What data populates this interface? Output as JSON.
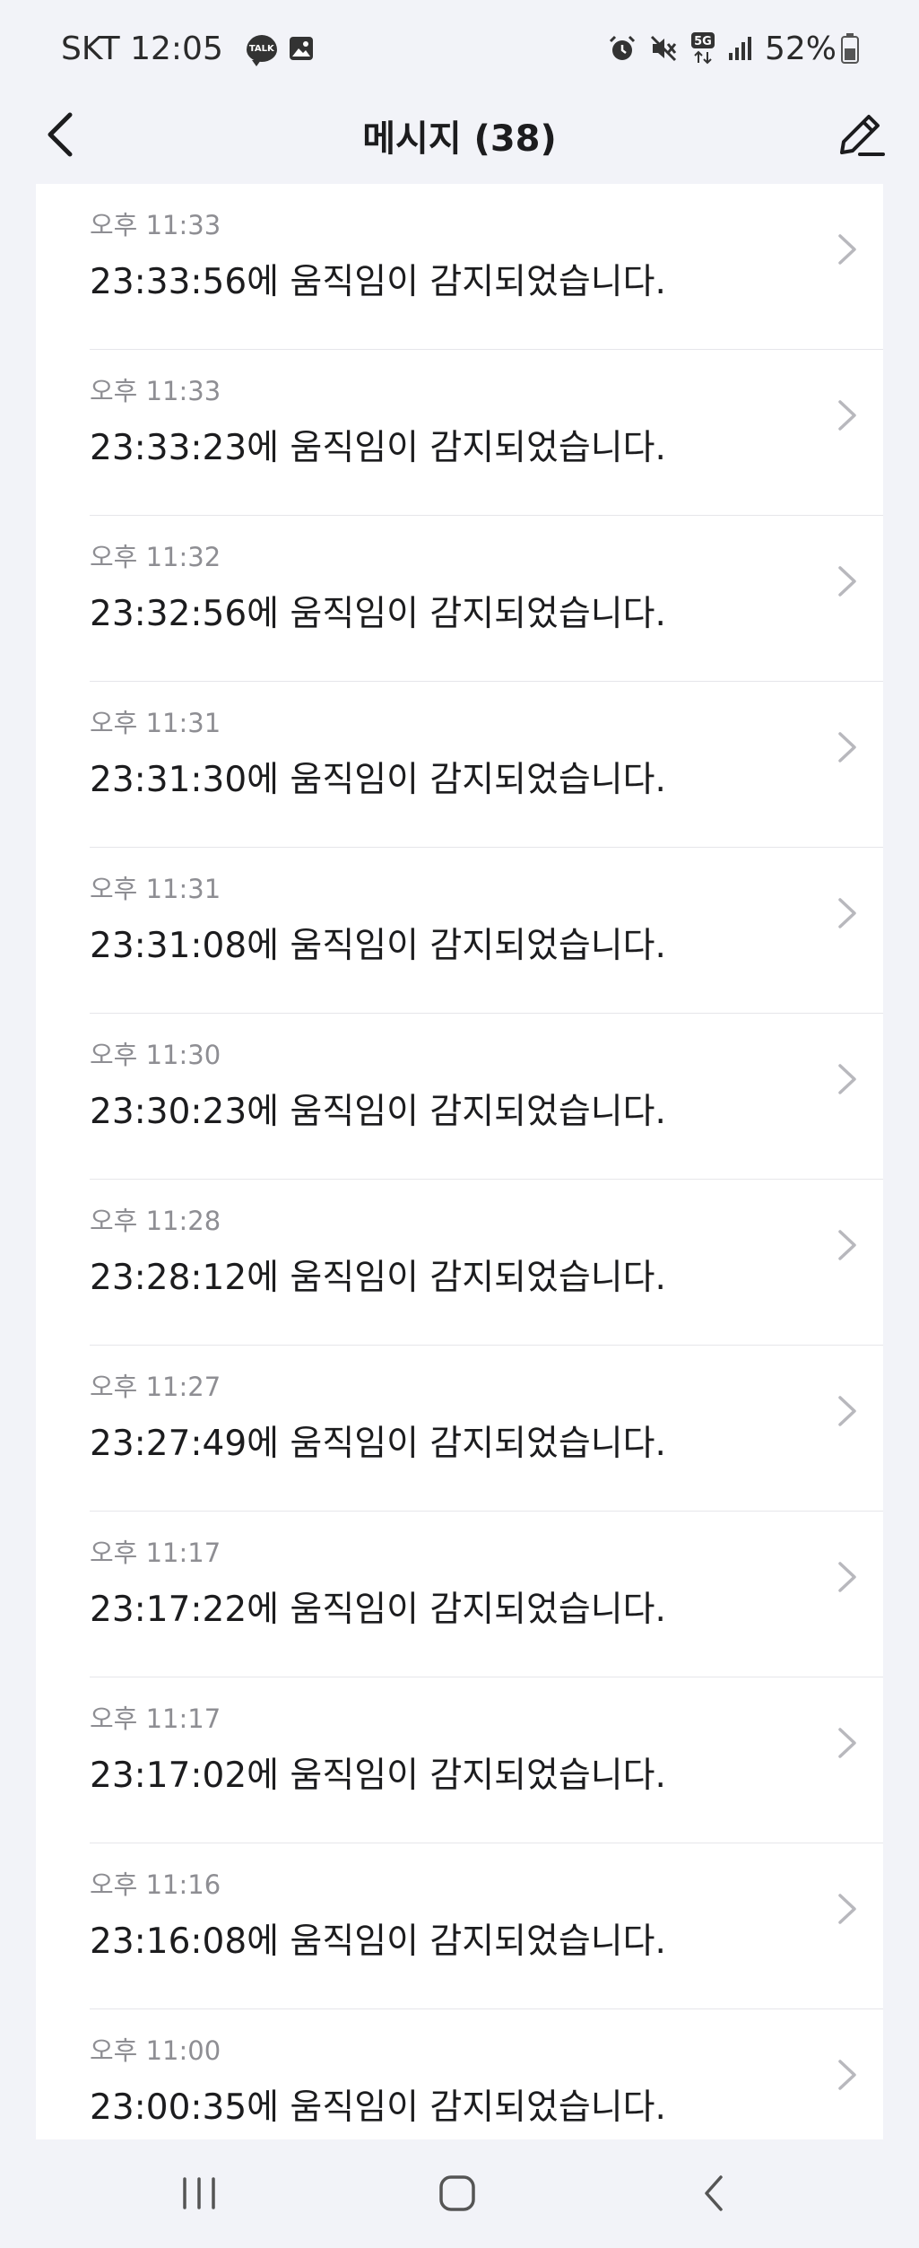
{
  "status_bar": {
    "carrier_time": "SKT 12:05",
    "talk_badge": "TALK",
    "battery": "52%",
    "network": "5G",
    "icons": [
      "talk-icon",
      "image-icon",
      "alarm-icon",
      "mute-icon",
      "5g-icon",
      "signal-icon",
      "battery-icon"
    ]
  },
  "header": {
    "title": "메시지 (38)",
    "back_icon": "back-arrow-icon",
    "edit_icon": "pencil-icon"
  },
  "messages": [
    {
      "time": "오후 11:33",
      "text": "23:33:56에 움직임이 감지되었습니다."
    },
    {
      "time": "오후 11:33",
      "text": "23:33:23에 움직임이 감지되었습니다."
    },
    {
      "time": "오후 11:32",
      "text": "23:32:56에 움직임이 감지되었습니다."
    },
    {
      "time": "오후 11:31",
      "text": "23:31:30에 움직임이 감지되었습니다."
    },
    {
      "time": "오후 11:31",
      "text": "23:31:08에 움직임이 감지되었습니다."
    },
    {
      "time": "오후 11:30",
      "text": "23:30:23에 움직임이 감지되었습니다."
    },
    {
      "time": "오후 11:28",
      "text": "23:28:12에 움직임이 감지되었습니다."
    },
    {
      "time": "오후 11:27",
      "text": "23:27:49에 움직임이 감지되었습니다."
    },
    {
      "time": "오후 11:17",
      "text": "23:17:22에 움직임이 감지되었습니다."
    },
    {
      "time": "오후 11:17",
      "text": "23:17:02에 움직임이 감지되었습니다."
    },
    {
      "time": "오후 11:16",
      "text": "23:16:08에 움직임이 감지되었습니다."
    },
    {
      "time": "오후 11:00",
      "text": "23:00:35에 움직임이 감지되었습니다."
    }
  ],
  "nav_bar": {
    "icons": [
      "recents-icon",
      "home-icon",
      "back-icon"
    ]
  },
  "colors": {
    "background": "#f2f3f8",
    "card": "#ffffff",
    "primary_text": "#1c1c1e",
    "secondary_text": "#8e8e93",
    "chevron": "#b8b8bd"
  }
}
